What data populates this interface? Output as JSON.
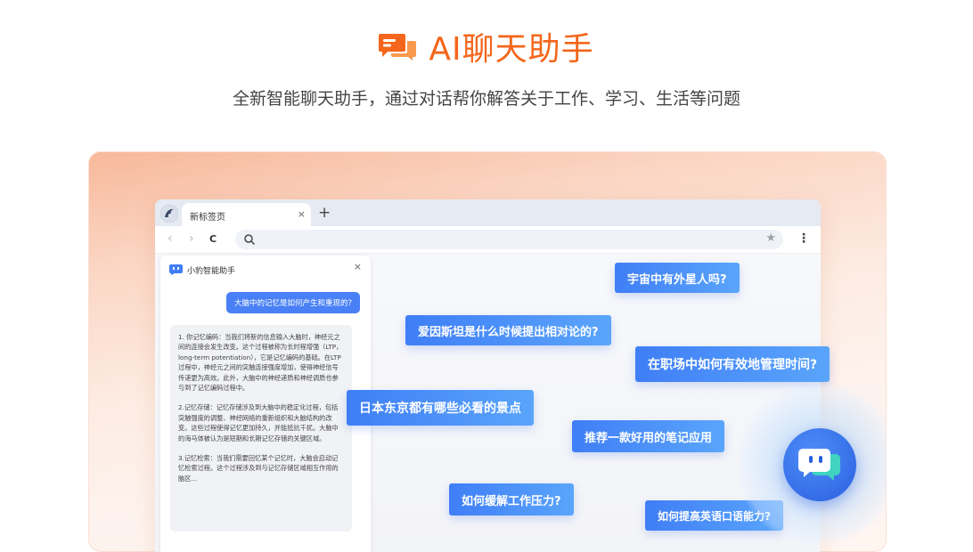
{
  "header": {
    "title": "AI聊天助手",
    "subtitle": "全新智能聊天助手，通过对话帮你解答关于工作、学习、生活等问题",
    "accent_color": "#f4661b",
    "logo_icon": "chat-bubbles-icon"
  },
  "browser": {
    "tab_title": "新标签页",
    "tab_close": "×",
    "new_tab": "+",
    "nav": {
      "back": "‹",
      "forward": "›",
      "reload": "C",
      "menu": "⋮",
      "star": "★"
    }
  },
  "assistant_panel": {
    "title": "小豹智能助手",
    "close": "×",
    "user_message": "大脑中的记忆是如何产生和重现的?",
    "answer_paragraphs": [
      "1. 你记忆编码：当我们将新的信息输入大脑时，神经元之间的连接会发生改变。这个过程被称为长时程增强（LTP，long-term potentiation），它是记忆编码的基础。在LTP过程中，神经元之间的突触连接强度增加，使得神经信号传递更为高效。此外，大脑中的神经递质和神经调质也参与到了记忆编码过程中。",
      "2.记忆存储：记忆存储涉及到大脑中的稳定化过程，包括突触强度的调整、神经网络的重新组织和大脑结构的改变。这些过程使得记忆更加持久，并能抵抗干扰。大脑中的海马体被认为是短期和长期记忆存储的关键区域。",
      "3.记忆检索：当我们需要回忆某个记忆时，大脑会启动记忆检索过程。这个过程涉及到与记忆存储区域相互作用的脑区..."
    ]
  },
  "questions": [
    "宇宙中有外星人吗?",
    "爱因斯坦是什么时候提出相对论的?",
    "在职场中如何有效地管理时间?",
    "日本东京都有哪些必看的景点",
    "推荐一款好用的笔记应用",
    "如何缓解工作压力?",
    "如何提高英语口语能力?"
  ],
  "floating_button_icon": "chat-assistant-icon"
}
